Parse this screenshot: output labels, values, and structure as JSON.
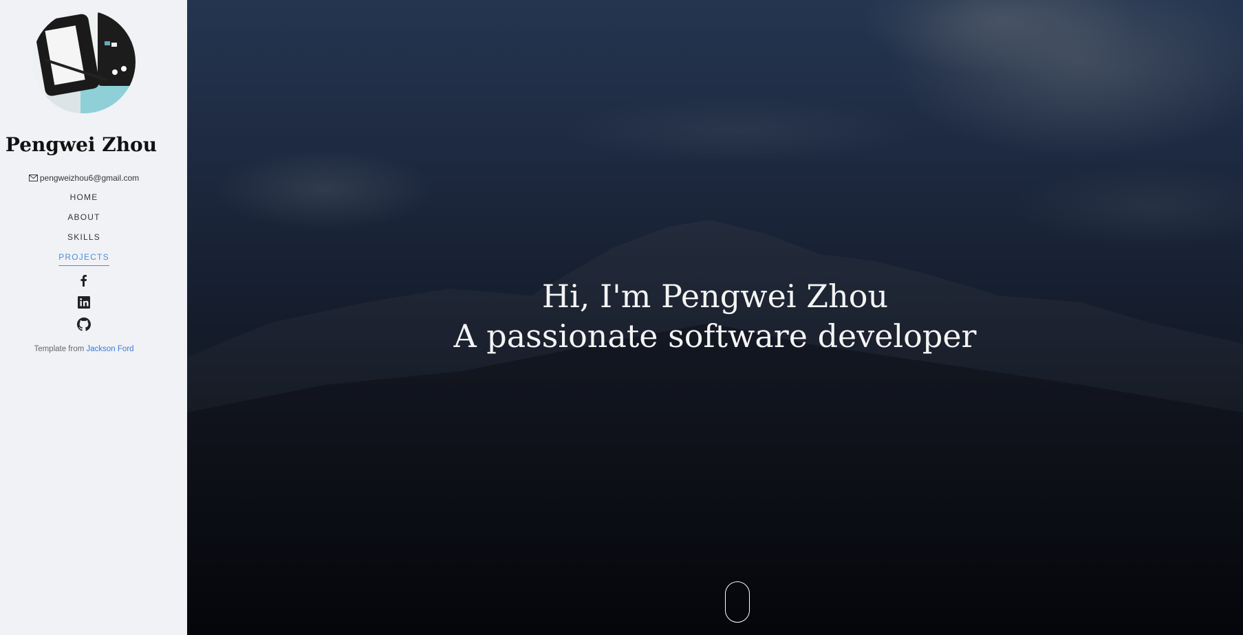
{
  "sidebar": {
    "name": "Pengwei Zhou",
    "email": "pengweizhou6@gmail.com",
    "nav": [
      {
        "label": "HOME"
      },
      {
        "label": "ABOUT"
      },
      {
        "label": "SKILLS"
      },
      {
        "label": "PROJECTS",
        "active": true
      }
    ],
    "social": [
      {
        "icon": "facebook-icon"
      },
      {
        "icon": "linkedin-icon"
      },
      {
        "icon": "github-icon"
      }
    ],
    "credit_prefix": "Template from",
    "credit_link": "Jackson Ford"
  },
  "hero": {
    "line1": "Hi, I'm Pengwei Zhou",
    "line2": "A passionate software developer"
  },
  "colors": {
    "sidebar_bg": "#f1f2f6",
    "accent": "#4c8bd6",
    "hero_top": "#253550",
    "hero_bottom": "#030407"
  }
}
